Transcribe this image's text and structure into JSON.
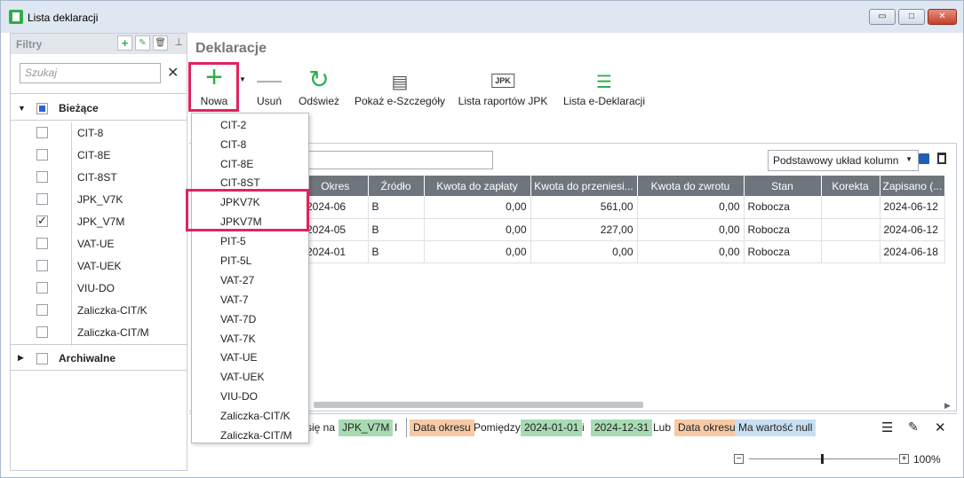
{
  "window": {
    "title": "Lista deklaracji",
    "controls": {
      "minimize": "▭",
      "maximize": "□",
      "close": "✕"
    }
  },
  "filters": {
    "title": "Filtry",
    "search_placeholder": "Szukaj",
    "groups": [
      {
        "label": "Bieżące",
        "state": "partial",
        "expanded": true,
        "items": [
          {
            "label": "CIT-8",
            "checked": false
          },
          {
            "label": "CIT-8E",
            "checked": false
          },
          {
            "label": "CIT-8ST",
            "checked": false
          },
          {
            "label": "JPK_V7K",
            "checked": false
          },
          {
            "label": "JPK_V7M",
            "checked": true
          },
          {
            "label": "VAT-UE",
            "checked": false
          },
          {
            "label": "VAT-UEK",
            "checked": false
          },
          {
            "label": "VIU-DO",
            "checked": false
          },
          {
            "label": "Zaliczka-CIT/K",
            "checked": false
          },
          {
            "label": "Zaliczka-CIT/M",
            "checked": false
          }
        ]
      },
      {
        "label": "Archiwalne",
        "state": "unchecked",
        "expanded": false,
        "items": []
      }
    ]
  },
  "content": {
    "title": "Deklaracje"
  },
  "toolbar": {
    "new": "Nowa",
    "delete": "Usuń",
    "refresh": "Odśwież",
    "show_details": "Pokaż e-Szczegóły",
    "jpk_reports": "Lista raportów JPK",
    "edeclarations": "Lista e-Deklaracji",
    "jpk_icon_text": "JPK"
  },
  "layout_select": {
    "value": "Podstawowy układ kolumn"
  },
  "grid": {
    "columns": [
      "Okres",
      "Źródło",
      "Kwota do zapłaty",
      "Kwota do przeniesi...",
      "Kwota do zwrotu",
      "Stan",
      "Korekta",
      "Zapisano (..."
    ],
    "rows": [
      [
        "2024-06",
        "B",
        "0,00",
        "561,00",
        "0,00",
        "Robocza",
        "",
        "2024-06-12"
      ],
      [
        "2024-05",
        "B",
        "0,00",
        "227,00",
        "0,00",
        "Robocza",
        "",
        "2024-06-12"
      ],
      [
        "2024-01",
        "B",
        "0,00",
        "0,00",
        "0,00",
        "Robocza",
        "",
        "2024-06-18"
      ]
    ]
  },
  "filterbar": {
    "t1": "się na",
    "t2": "JPK_V7M",
    "t3": "I",
    "t4": "Data okresu",
    "t5": "Pomiędzy",
    "t6": "2024-01-01",
    "t7": "i",
    "t8": "2024-12-31",
    "t9": "Lub",
    "t10": "Data okresu",
    "t11": "Ma wartość null"
  },
  "zoom": {
    "value": "100%",
    "level_percent": 100
  },
  "dropdown": {
    "items": [
      "CIT-2",
      "CIT-8",
      "CIT-8E",
      "CIT-8ST",
      "JPKV7K",
      "JPKV7M",
      "PIT-5",
      "PIT-5L",
      "VAT-27",
      "VAT-7",
      "VAT-7D",
      "VAT-7K",
      "VAT-UE",
      "VAT-UEK",
      "VIU-DO",
      "Zaliczka-CIT/K",
      "Zaliczka-CIT/M"
    ]
  },
  "colors": {
    "accent_green": "#2eae4b",
    "highlight": "#e0245e",
    "header_gray": "#6f757d"
  }
}
